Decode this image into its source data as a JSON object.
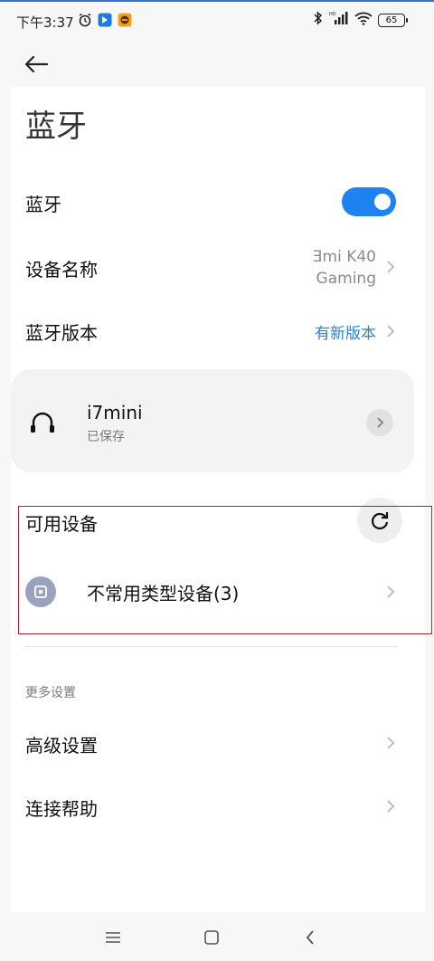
{
  "status_bar": {
    "time": "下午3:37",
    "battery": "65",
    "left_icons": [
      "alarm-icon",
      "app-notification-blue-icon",
      "app-notification-orange-icon"
    ],
    "right_icons": [
      "bluetooth-icon",
      "hd-signal-icon",
      "wifi-icon",
      "battery-icon"
    ]
  },
  "header": {
    "title": "蓝牙"
  },
  "settings": {
    "bluetooth_label": "蓝牙",
    "bluetooth_enabled": true,
    "device_name_label": "设备名称",
    "device_name_value_line1": "Ǝmi K40",
    "device_name_value_line2": "Gaming",
    "version_label": "蓝牙版本",
    "version_value": "有新版本"
  },
  "saved_devices": [
    {
      "name": "i7mini",
      "status": "已保存",
      "icon": "headphones-icon"
    }
  ],
  "available": {
    "title": "可用设备",
    "refresh_icon": "refresh-icon",
    "items": [
      {
        "label": "不常用类型设备(3)",
        "icon": "device-box-icon"
      }
    ]
  },
  "more_settings": {
    "header": "更多设置",
    "items": [
      {
        "label": "高级设置"
      },
      {
        "label": "连接帮助"
      }
    ]
  },
  "nav_bar": {
    "icons": [
      "menu-icon",
      "home-icon",
      "back-icon"
    ]
  },
  "colors": {
    "accent": "#1d82f2",
    "link": "#2a83d9",
    "highlight_border": "#b3202a",
    "device_icon_bg": "#9aa2bd"
  }
}
